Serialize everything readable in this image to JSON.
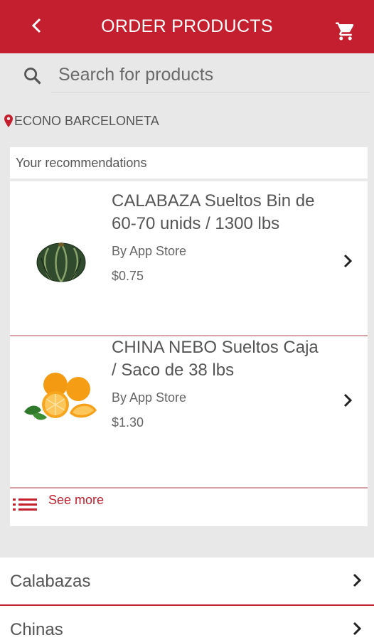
{
  "header": {
    "title": "ORDER PRODUCTS",
    "back_icon": "back-arrow-icon",
    "cart_icon": "cart-icon",
    "background": "#c41f2e"
  },
  "search": {
    "placeholder": "Search for products",
    "value": ""
  },
  "location": {
    "label": "ECONO BARCELONETA",
    "icon": "map-pin-icon"
  },
  "recommendations": {
    "heading": "Your recommendations",
    "items": [
      {
        "name": "CALABAZA Sueltos Bin de 60-70 unids / 1300 lbs",
        "by": "By App Store",
        "price": "$0.75",
        "image": "pumpkin-image"
      },
      {
        "name": "CHINA NEBO Sueltos Caja / Saco de 38 lbs",
        "by": "By App Store",
        "price": "$1.30",
        "image": "oranges-image"
      }
    ],
    "see_more": "See more"
  },
  "categories": [
    {
      "label": "Calabazas"
    },
    {
      "label": "Chinas"
    }
  ],
  "colors": {
    "accent": "#c41f2e",
    "divider": "#d9a2a7"
  }
}
